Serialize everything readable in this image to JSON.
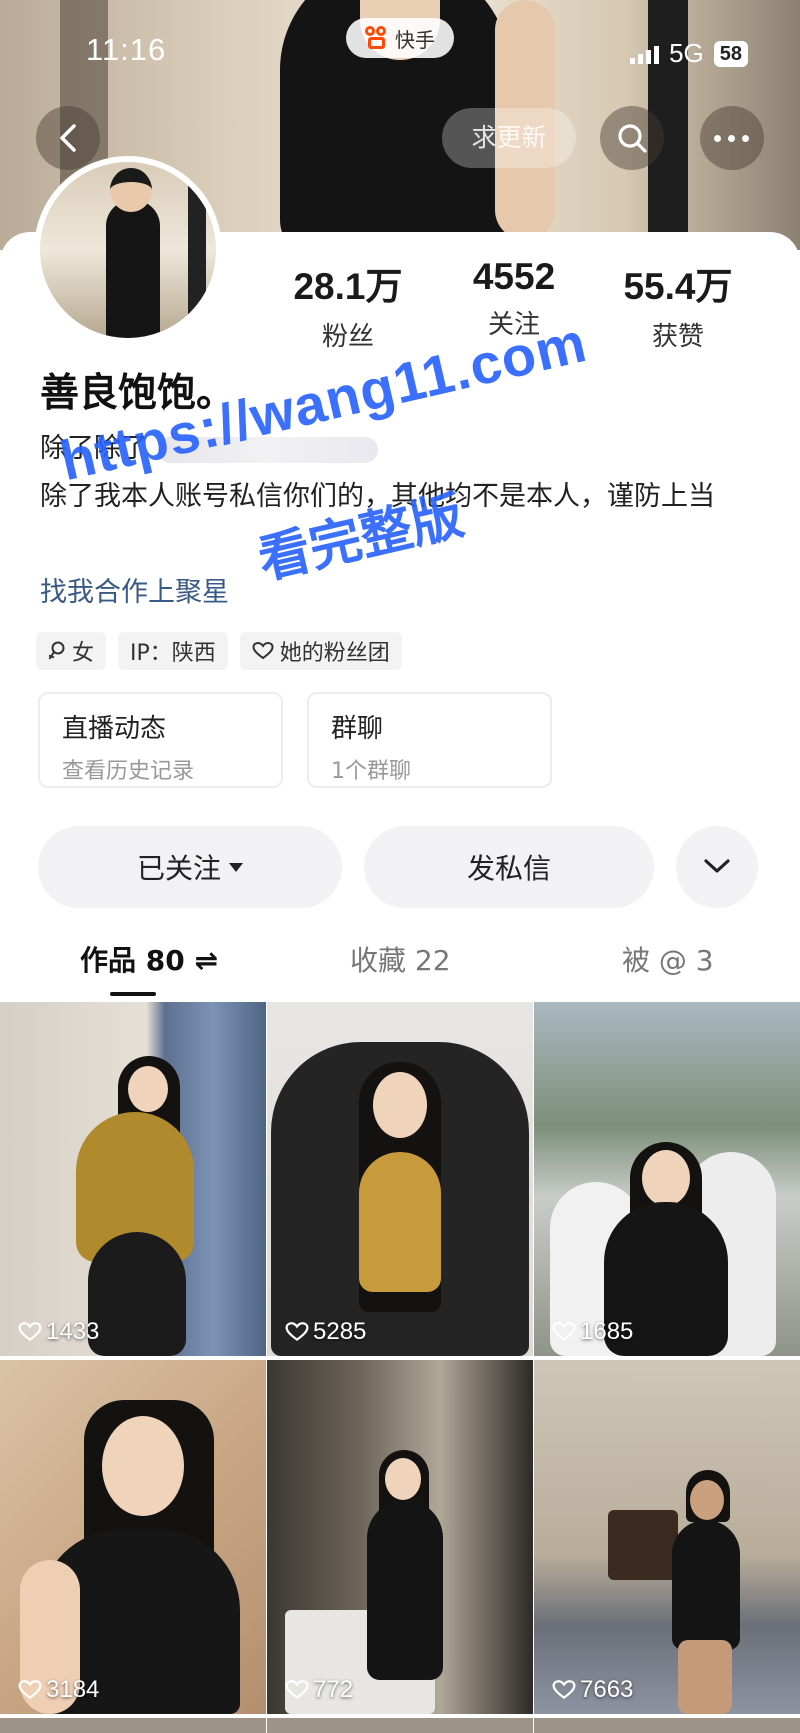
{
  "status_bar": {
    "time": "11:16",
    "network": "5G",
    "battery": "58"
  },
  "app": {
    "name": "快手"
  },
  "header": {
    "request_update_label": "求更新"
  },
  "profile": {
    "nickname": "善良饱饱。",
    "bio_line1": "除了除了",
    "bio_line2": "除了我本人账号私信你们的，其他均不是本人，谨防上当",
    "business_link": "找我合作上聚星",
    "stats": [
      {
        "value": "28.1万",
        "label": "粉丝"
      },
      {
        "value": "4552",
        "label": "关注"
      },
      {
        "value": "55.4万",
        "label": "获赞"
      }
    ],
    "tags": [
      {
        "icon": "female-icon",
        "label": "女"
      },
      {
        "icon": "",
        "label": "IP：陕西"
      },
      {
        "icon": "heart-icon",
        "label": "她的粉丝团"
      }
    ],
    "cards": [
      {
        "title": "直播动态",
        "subtitle": "查看历史记录"
      },
      {
        "title": "群聊",
        "subtitle": "1个群聊"
      }
    ]
  },
  "actions": {
    "follow_label": "已关注",
    "message_label": "发私信"
  },
  "tabs": [
    {
      "label": "作品 80 ⇌",
      "active": true
    },
    {
      "label": "收藏 22",
      "active": false
    },
    {
      "label": "被 @ 3",
      "active": false
    }
  ],
  "works": [
    {
      "likes": "1433"
    },
    {
      "likes": "5285"
    },
    {
      "likes": "1685"
    },
    {
      "likes": "3184"
    },
    {
      "likes": "772"
    },
    {
      "likes": "7663"
    }
  ],
  "watermark": {
    "url": "https://wang11.com",
    "text": "看完整版"
  },
  "colors": {
    "accent_link": "#3a5a86",
    "watermark": "#2660ff",
    "app_brand": "#ff4906"
  }
}
